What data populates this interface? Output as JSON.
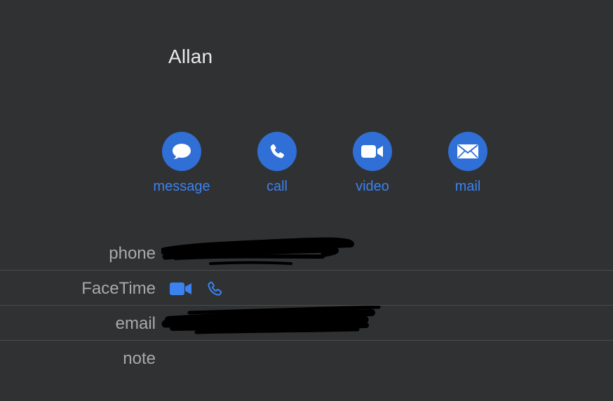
{
  "contact": {
    "name": "Allan"
  },
  "actions": [
    {
      "label": "message",
      "icon": "message-bubble-icon"
    },
    {
      "label": "call",
      "icon": "phone-icon"
    },
    {
      "label": "video",
      "icon": "video-camera-icon"
    },
    {
      "label": "mail",
      "icon": "envelope-icon"
    }
  ],
  "fields": {
    "phone": {
      "label": "phone",
      "value_redacted": true
    },
    "facetime": {
      "label": "FaceTime",
      "icons": [
        "video-camera-icon",
        "phone-icon"
      ]
    },
    "email": {
      "label": "email",
      "value_redacted": true
    },
    "note": {
      "label": "note"
    }
  },
  "colors": {
    "background": "#303132",
    "accent": "#2f6fd6",
    "accent_text": "#3b82f0",
    "label_text": "#a9a9a9",
    "name_text": "#e9e9e9",
    "divider": "#4a4b4c",
    "redaction": "#000000"
  }
}
